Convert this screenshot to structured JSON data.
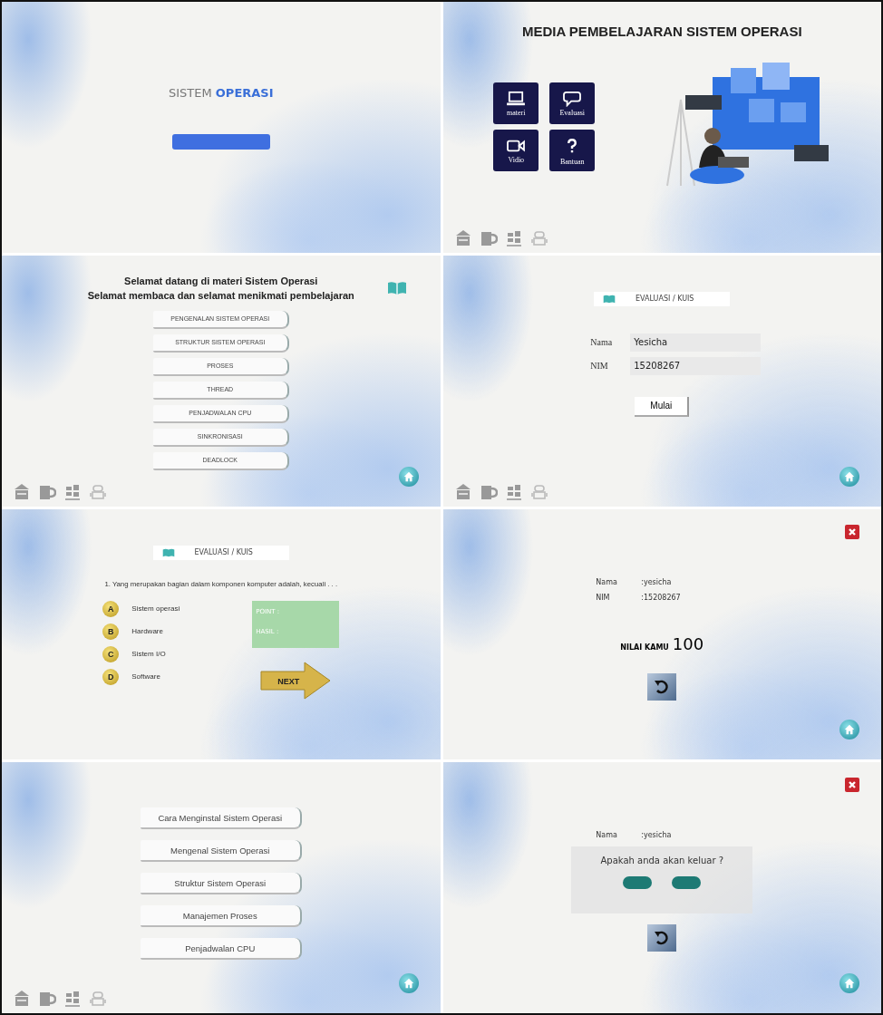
{
  "screens": [
    {
      "kind": "splash",
      "title": "SISTEM",
      "title_highlight": "OPERASI"
    },
    {
      "kind": "main_menu",
      "title": "MEDIA PEMBELAJARAN SISTEM OPERASI",
      "tiles": [
        {
          "kind": "laptop",
          "label": "materi"
        },
        {
          "kind": "chat",
          "label": "Evaluasi"
        },
        {
          "kind": "video",
          "label": "Vidio"
        },
        {
          "kind": "help",
          "label": "Bantuan"
        }
      ]
    },
    {
      "kind": "materi",
      "heading_lines": [
        "Selamat datang di materi Sistem Operasi",
        "Selamat membaca dan selamat menikmati pembelajaran"
      ],
      "topics": [
        "PENGENALAN SISTEM OPERASI",
        "STRUKTUR SISTEM OPERASI",
        "PROSES",
        "THREAD",
        "PENJADWALAN CPU",
        "SINKRONISASI",
        "DEADLOCK"
      ]
    },
    {
      "kind": "login",
      "header": "EVALUASI / KUIS",
      "fields": [
        {
          "label": "Nama",
          "value": "Yesicha"
        },
        {
          "label": "NIM",
          "value": "15208267"
        }
      ],
      "button": "Mulai"
    },
    {
      "kind": "quiz",
      "header": "EVALUASI / KUIS",
      "question": "1. Yang merupakan bagian dalam komponen komputer adalah, kecuali . . .",
      "options": [
        {
          "letter": "A",
          "text": "Sistem operasi"
        },
        {
          "letter": "B",
          "text": "Hardware"
        },
        {
          "letter": "C",
          "text": "Sistem I/O"
        },
        {
          "letter": "D",
          "text": "Software"
        }
      ],
      "score_labels": [
        "POINT :",
        "HASIL :"
      ],
      "next": "NEXT"
    },
    {
      "kind": "result",
      "rows": [
        {
          "label": "Nama",
          "value": ":yesicha"
        },
        {
          "label": "NIM",
          "value": ":15208267"
        }
      ],
      "score_label": "NILAI KAMU",
      "score": "100"
    },
    {
      "kind": "topic_list",
      "topics": [
        "Cara Menginstal Sistem Operasi",
        "Mengenal Sistem Operasi",
        "Struktur Sistem Operasi",
        "Manajemen Proses",
        "Penjadwalan CPU"
      ]
    },
    {
      "kind": "exit_dialog",
      "rows": [
        {
          "label": "Nama",
          "value": ":yesicha"
        }
      ],
      "dialog": {
        "message": "Apakah anda akan keluar ?"
      }
    }
  ]
}
